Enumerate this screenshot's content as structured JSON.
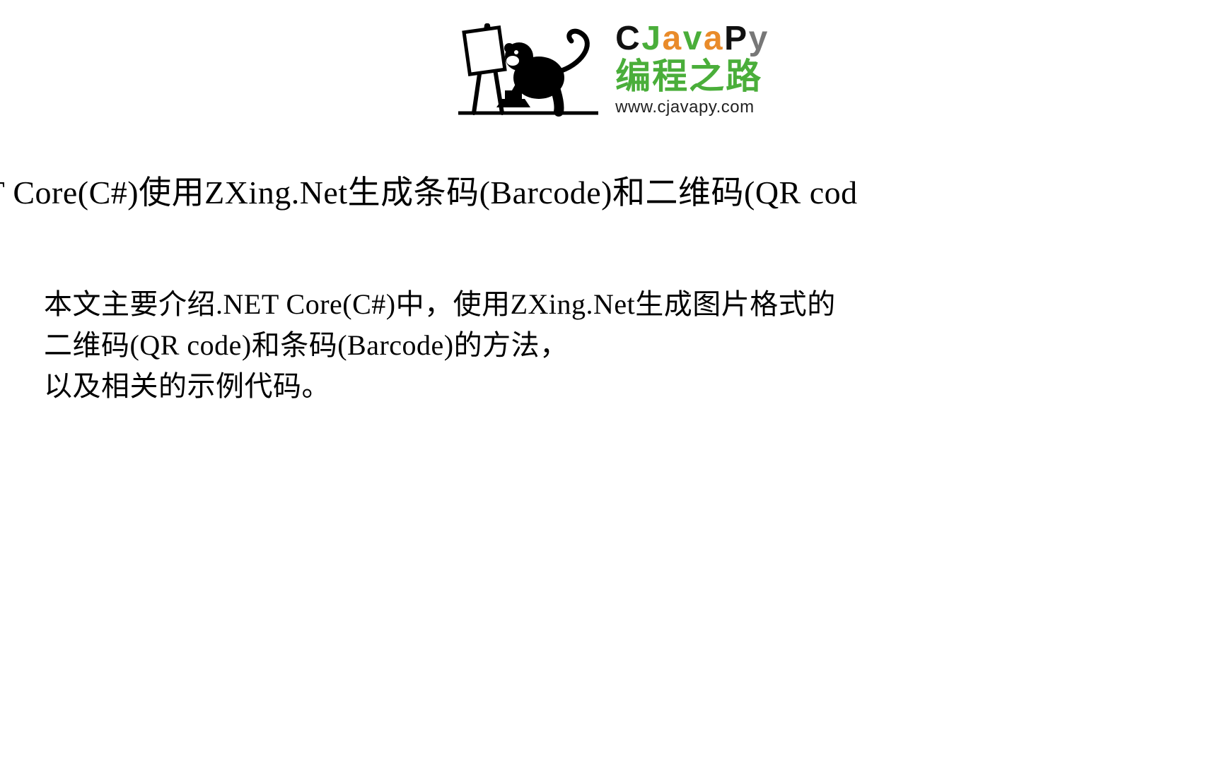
{
  "logo": {
    "brand_letters": [
      "C",
      "J",
      "a",
      "v",
      "a",
      "P",
      "y"
    ],
    "brand_colors": [
      "c-blk",
      "c-grn",
      "c-org",
      "c-grn",
      "c-org",
      "c-blk",
      "c-gry"
    ],
    "tagline": "编程之路",
    "url": "www.cjavapy.com"
  },
  "title": "ET Core(C#)使用ZXing.Net生成条码(Barcode)和二维码(QR cod",
  "body": {
    "line1": "本文主要介绍.NET Core(C#)中，使用ZXing.Net生成图片格式的",
    "line2": "二维码(QR code)和条码(Barcode)的方法，",
    "line3": "以及相关的示例代码。"
  }
}
